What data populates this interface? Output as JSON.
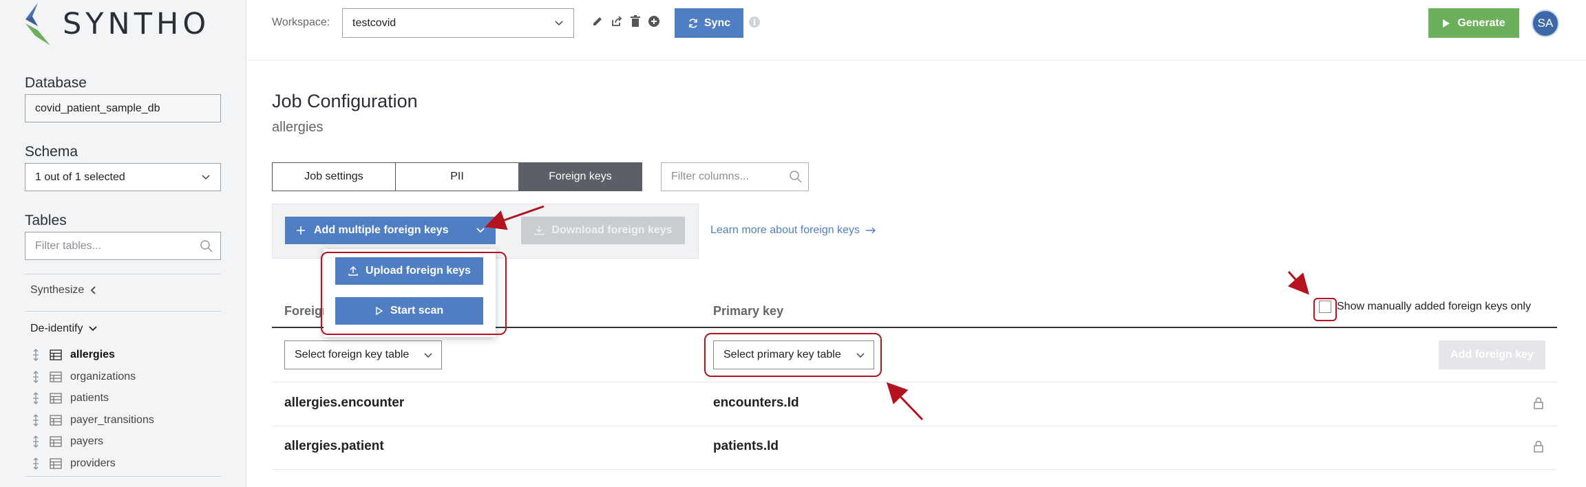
{
  "brand": {
    "logo_text": "SYNTHO"
  },
  "sidebar": {
    "database_label": "Database",
    "database_value": "covid_patient_sample_db",
    "schema_label": "Schema",
    "schema_value": "1 out of 1 selected",
    "tables_label": "Tables",
    "tables_filter_placeholder": "Filter tables...",
    "synthesize_label": "Synthesize",
    "deidentify_label": "De-identify",
    "tables": [
      {
        "name": "allergies",
        "active": true
      },
      {
        "name": "organizations"
      },
      {
        "name": "patients"
      },
      {
        "name": "payer_transitions"
      },
      {
        "name": "payers"
      },
      {
        "name": "providers"
      }
    ]
  },
  "topbar": {
    "workspace_label": "Workspace:",
    "workspace_value": "testcovid",
    "sync_label": "Sync",
    "generate_label": "Generate",
    "avatar_initials": "SA"
  },
  "main": {
    "title": "Job Configuration",
    "subtitle": "allergies",
    "tabs": [
      {
        "label": "Job settings"
      },
      {
        "label": "PII"
      },
      {
        "label": "Foreign keys",
        "active": true
      }
    ],
    "filter_columns_placeholder": "Filter columns...",
    "add_multiple_label": "Add multiple foreign keys",
    "download_label": "Download foreign keys",
    "learn_more_label": "Learn more about foreign keys",
    "dropdown": {
      "upload_label": "Upload foreign keys",
      "scan_label": "Start scan"
    },
    "columns": {
      "foreign_key": "Foreign key",
      "primary_key": "Primary key"
    },
    "manual_only_label": "Show manually added foreign keys only",
    "select_fk_table": "Select foreign key table",
    "select_pk_table": "Select primary key table",
    "add_fk_label": "Add foreign key",
    "rows": [
      {
        "foreign": "allergies.encounter",
        "primary": "encounters.Id"
      },
      {
        "foreign": "allergies.patient",
        "primary": "patients.Id"
      }
    ]
  },
  "colors": {
    "primary": "#4f7fc2",
    "generate": "#6db05b",
    "annotation": "#b3121e",
    "active_tab": "#5b5f66"
  }
}
